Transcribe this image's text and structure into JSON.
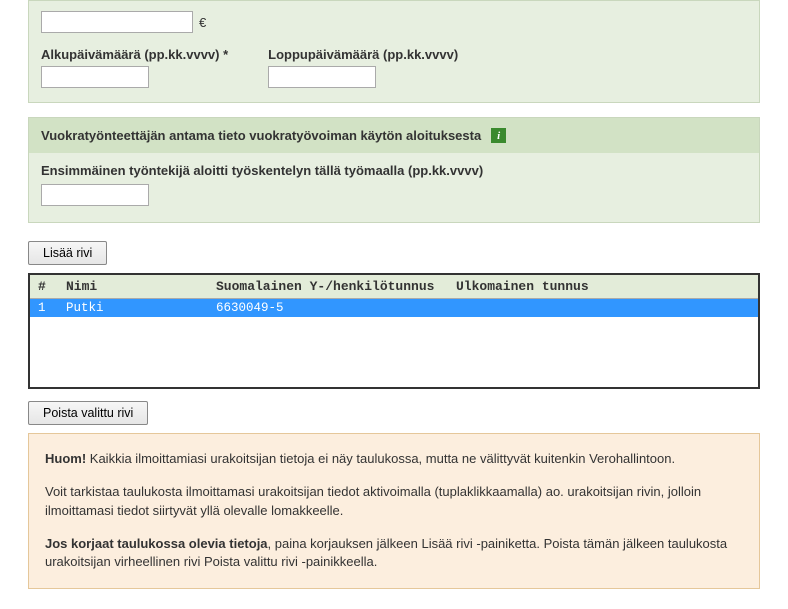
{
  "euroSymbol": "€",
  "dates": {
    "startLabel": "Alkupäivämäärä (pp.kk.vvvv) *",
    "endLabel": "Loppupäivämäärä (pp.kk.vvvv)"
  },
  "section2": {
    "title": "Vuokratyönteettäjän antama tieto vuokratyövoiman käytön aloituksesta",
    "fieldLabel": "Ensimmäinen työntekijä aloitti työskentelyn tällä työmaalla (pp.kk.vvvv)"
  },
  "buttons": {
    "addRow": "Lisää rivi",
    "deleteRow": "Poista valittu rivi"
  },
  "table": {
    "headers": {
      "idx": "#",
      "name": "Nimi",
      "fin": "Suomalainen Y-/henkilötunnus",
      "foreign": "Ulkomainen tunnus"
    },
    "rows": [
      {
        "idx": "1",
        "name": "Putki",
        "fin": "6630049-5",
        "foreign": ""
      }
    ]
  },
  "notice": {
    "p1a": "Huom!",
    "p1b": " Kaikkia ilmoittamiasi urakoitsijan tietoja ei näy taulukossa, mutta ne välittyvät kuitenkin Verohallintoon.",
    "p2": "Voit tarkistaa taulukosta ilmoittamasi urakoitsijan tiedot aktivoimalla (tuplaklikkaamalla) ao. urakoitsijan rivin, jolloin ilmoittamasi tiedot siirtyvät yllä olevalle lomakkeelle.",
    "p3a": "Jos korjaat taulukossa olevia tietoja",
    "p3b": ", paina korjauksen jälkeen Lisää rivi -painiketta. Poista tämän jälkeen taulukosta urakoitsijan virheellinen rivi Poista valittu rivi -painikkeella."
  }
}
